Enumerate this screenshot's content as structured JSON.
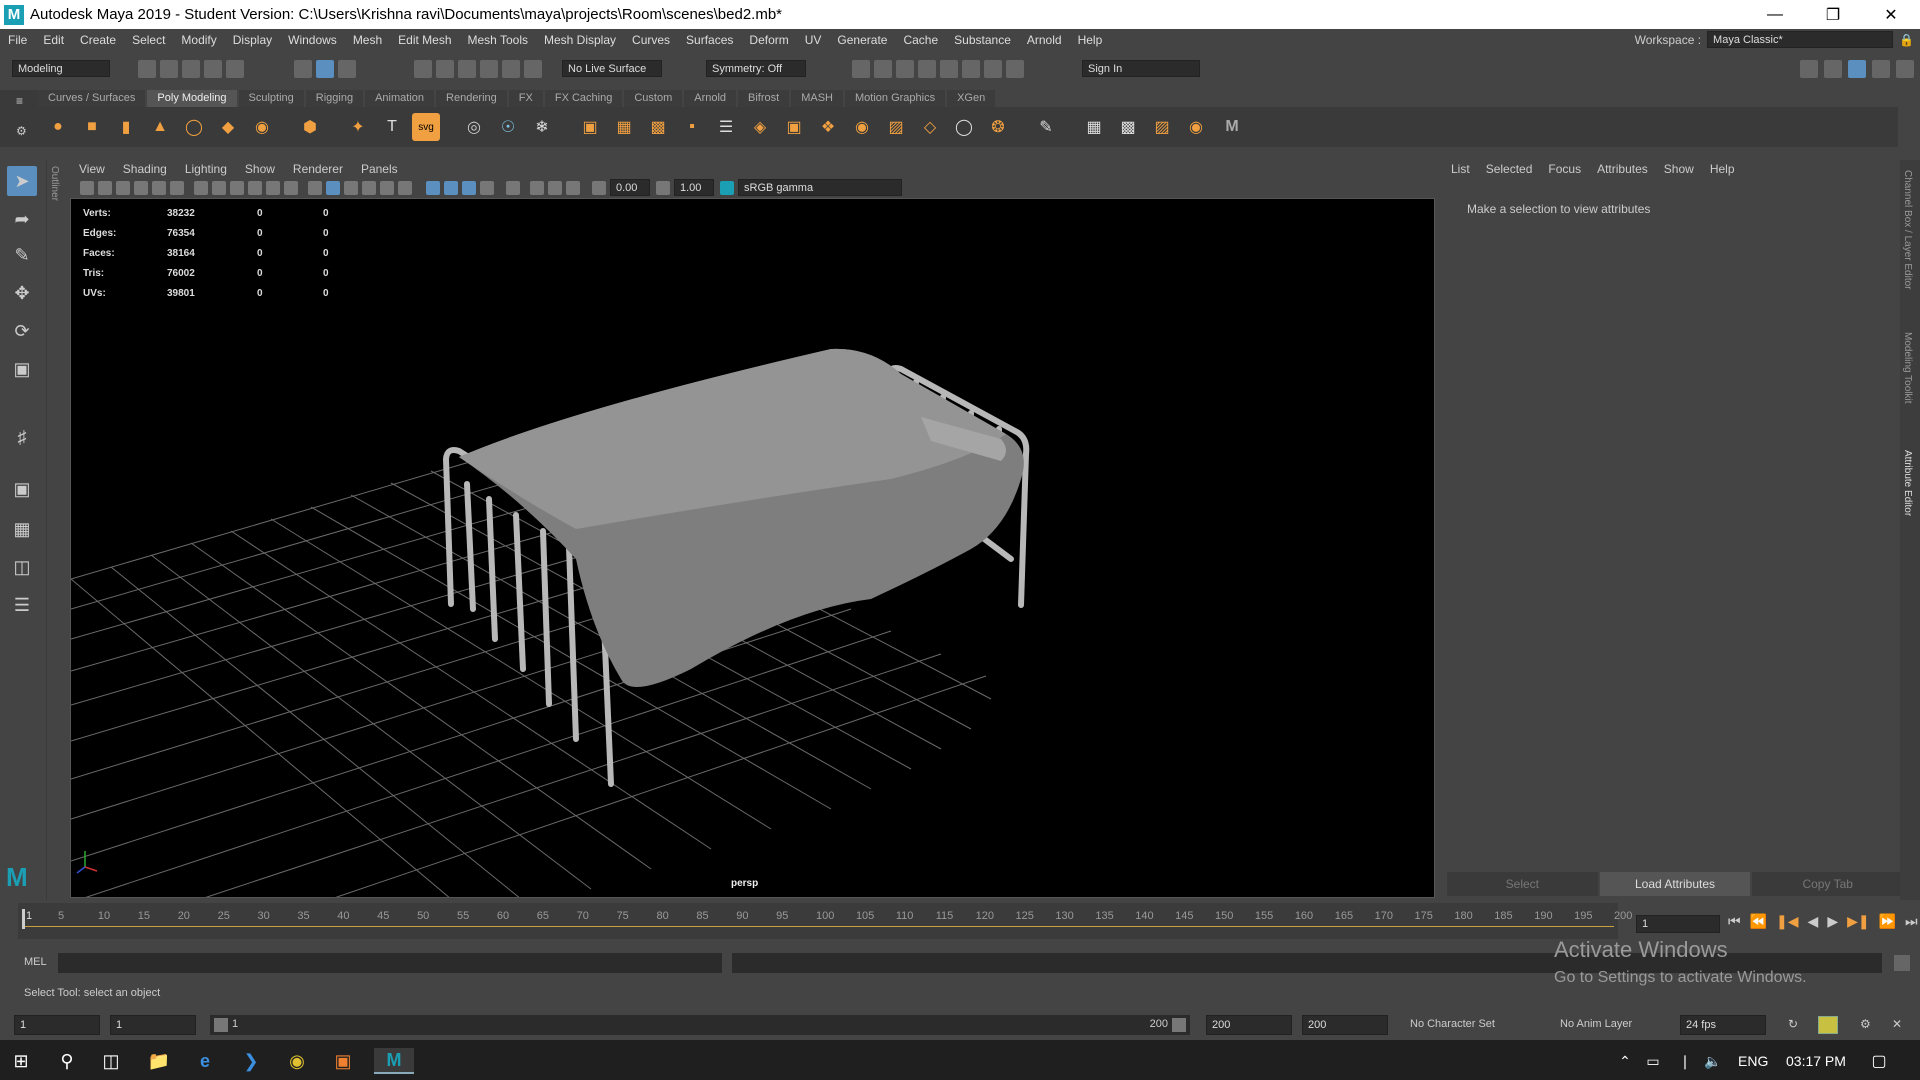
{
  "window": {
    "title": "Autodesk Maya 2019 - Student Version: C:\\Users\\Krishna ravi\\Documents\\maya\\projects\\Room\\scenes\\bed2.mb*",
    "logo": "M"
  },
  "menus": [
    "File",
    "Edit",
    "Create",
    "Select",
    "Modify",
    "Display",
    "Windows",
    "Mesh",
    "Edit Mesh",
    "Mesh Tools",
    "Mesh Display",
    "Curves",
    "Surfaces",
    "Deform",
    "UV",
    "Generate",
    "Cache",
    "Substance",
    "Arnold",
    "Help"
  ],
  "workspace": {
    "label": "Workspace :",
    "value": "Maya Classic*"
  },
  "statusline": {
    "menuset": "Modeling",
    "live_surface": "No Live Surface",
    "symmetry": "Symmetry: Off",
    "sign_in": "Sign In"
  },
  "shelf_tabs": [
    "Curves / Surfaces",
    "Poly Modeling",
    "Sculpting",
    "Rigging",
    "Animation",
    "Rendering",
    "FX",
    "FX Caching",
    "Custom",
    "Arnold",
    "Bifrost",
    "MASH",
    "Motion Graphics",
    "XGen"
  ],
  "active_shelf": "Poly Modeling",
  "outliner_label": "Outliner",
  "viewport": {
    "menus": [
      "View",
      "Shading",
      "Lighting",
      "Show",
      "Renderer",
      "Panels"
    ],
    "exposure": "0.00",
    "gamma": "1.00",
    "color_space": "sRGB gamma",
    "camera": "persp",
    "hud": [
      {
        "label": "Verts:",
        "v1": "38232",
        "v2": "0",
        "v3": "0"
      },
      {
        "label": "Edges:",
        "v1": "76354",
        "v2": "0",
        "v3": "0"
      },
      {
        "label": "Faces:",
        "v1": "38164",
        "v2": "0",
        "v3": "0"
      },
      {
        "label": "Tris:",
        "v1": "76002",
        "v2": "0",
        "v3": "0"
      },
      {
        "label": "UVs:",
        "v1": "39801",
        "v2": "0",
        "v3": "0"
      }
    ]
  },
  "attribute_editor": {
    "menus": [
      "List",
      "Selected",
      "Focus",
      "Attributes",
      "Show",
      "Help"
    ],
    "message": "Make a selection to view attributes",
    "buttons": [
      "Select",
      "Load Attributes",
      "Copy Tab"
    ]
  },
  "side_tabs": [
    "Channel Box / Layer Editor",
    "Modeling Toolkit",
    "Attribute Editor"
  ],
  "timeslider": {
    "ticks": [
      "5",
      "10",
      "15",
      "20",
      "25",
      "30",
      "35",
      "40",
      "45",
      "50",
      "55",
      "60",
      "65",
      "70",
      "75",
      "80",
      "85",
      "90",
      "95",
      "100",
      "105",
      "110",
      "115",
      "120",
      "125",
      "130",
      "135",
      "140",
      "145",
      "150",
      "155",
      "160",
      "165",
      "170",
      "175",
      "180",
      "185",
      "190",
      "195",
      "200"
    ],
    "first_tick": "1",
    "current_frame": "1"
  },
  "cmdline": {
    "lang": "MEL"
  },
  "help_line": "Select Tool: select an object",
  "range": {
    "start": "1",
    "min": "1",
    "bar_start": "1",
    "bar_end": "200",
    "end": "200",
    "max": "200",
    "character_set": "No Character Set",
    "anim_layer": "No Anim Layer",
    "fps": "24 fps"
  },
  "watermark": {
    "title": "Activate Windows",
    "subtitle": "Go to Settings to activate Windows."
  },
  "taskbar": {
    "lang": "ENG",
    "time": "03:17 PM"
  }
}
